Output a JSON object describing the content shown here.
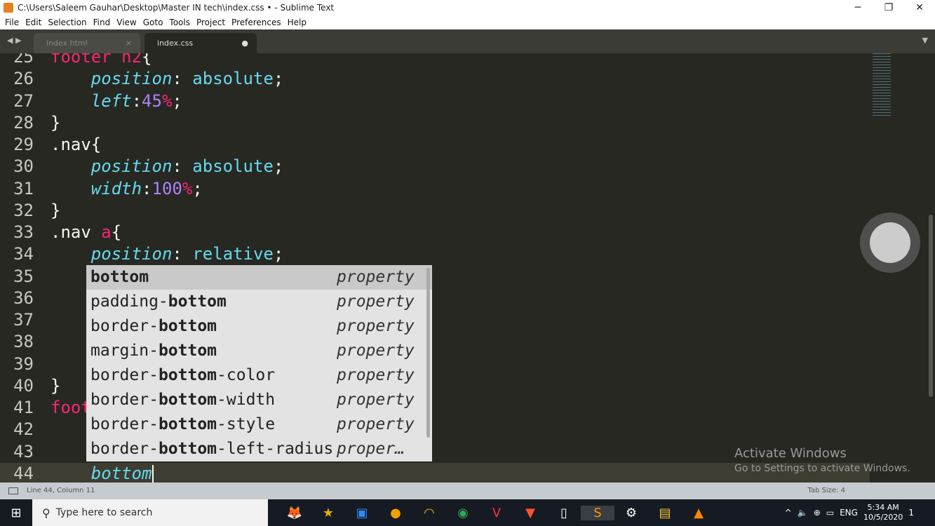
{
  "window": {
    "title": "C:\\Users\\Saleem Gauhar\\Desktop\\Master IN tech\\index.css • - Sublime Text",
    "minimize": "─",
    "restore": "❐",
    "close": "✕"
  },
  "menu": [
    "File",
    "Edit",
    "Selection",
    "Find",
    "View",
    "Goto",
    "Tools",
    "Project",
    "Preferences",
    "Help"
  ],
  "tabs": [
    {
      "label": "index.html",
      "close": "×"
    },
    {
      "label": "index.css",
      "modified": "●"
    }
  ],
  "tabnav": {
    "arrows": "◀ ▶",
    "menu": "▼"
  },
  "lines": [
    {
      "n": "25",
      "t": [
        [
          "kw",
          "footer h2"
        ],
        [
          "",
          "{"
        ]
      ]
    },
    {
      "n": "26",
      "t": [
        [
          "",
          "    "
        ],
        [
          "pr",
          "position"
        ],
        [
          "",
          ": "
        ],
        [
          "vl",
          "absolute"
        ],
        [
          "",
          ";"
        ]
      ]
    },
    {
      "n": "27",
      "t": [
        [
          "",
          "    "
        ],
        [
          "pr",
          "left"
        ],
        [
          "",
          ":"
        ],
        [
          "nu",
          "45"
        ],
        [
          "kw",
          "%"
        ],
        [
          "",
          ";"
        ]
      ]
    },
    {
      "n": "28",
      "t": [
        [
          "",
          "}"
        ]
      ]
    },
    {
      "n": "29",
      "t": [
        [
          "",
          ".nav{"
        ]
      ]
    },
    {
      "n": "30",
      "t": [
        [
          "",
          "    "
        ],
        [
          "pr",
          "position"
        ],
        [
          "",
          ": "
        ],
        [
          "vl",
          "absolute"
        ],
        [
          "",
          ";"
        ]
      ]
    },
    {
      "n": "31",
      "t": [
        [
          "",
          "    "
        ],
        [
          "pr",
          "width"
        ],
        [
          "",
          ":"
        ],
        [
          "nu",
          "100"
        ],
        [
          "kw",
          "%"
        ],
        [
          "",
          ";"
        ]
      ]
    },
    {
      "n": "32",
      "t": [
        [
          "",
          "}"
        ]
      ]
    },
    {
      "n": "33",
      "t": [
        [
          "",
          ".nav "
        ],
        [
          "kw",
          "a"
        ],
        [
          "",
          "{"
        ]
      ]
    },
    {
      "n": "34",
      "t": [
        [
          "",
          "    "
        ],
        [
          "pr",
          "position"
        ],
        [
          "",
          ": "
        ],
        [
          "vl",
          "relative"
        ],
        [
          "",
          ";"
        ]
      ]
    },
    {
      "n": "35",
      "t": []
    },
    {
      "n": "36",
      "t": []
    },
    {
      "n": "37",
      "t": []
    },
    {
      "n": "38",
      "t": []
    },
    {
      "n": "39",
      "t": []
    },
    {
      "n": "40",
      "t": [
        [
          "",
          "}"
        ]
      ]
    },
    {
      "n": "41",
      "t": [
        [
          "kw",
          "foot"
        ]
      ]
    },
    {
      "n": "42",
      "t": []
    },
    {
      "n": "43",
      "t": []
    },
    {
      "n": "44",
      "t": [
        [
          "",
          "    "
        ],
        [
          "pr",
          "bottom"
        ]
      ],
      "current": true
    }
  ],
  "autocomplete": [
    {
      "pre": "",
      "match": "bottom",
      "post": "",
      "kind": "property"
    },
    {
      "pre": "padding-",
      "match": "bottom",
      "post": "",
      "kind": "property"
    },
    {
      "pre": "border-",
      "match": "bottom",
      "post": "",
      "kind": "property"
    },
    {
      "pre": "margin-",
      "match": "bottom",
      "post": "",
      "kind": "property"
    },
    {
      "pre": "border-",
      "match": "bottom",
      "post": "-color",
      "kind": "property"
    },
    {
      "pre": "border-",
      "match": "bottom",
      "post": "-width",
      "kind": "property"
    },
    {
      "pre": "border-",
      "match": "bottom",
      "post": "-style",
      "kind": "property"
    },
    {
      "pre": "border-",
      "match": "bottom",
      "post": "-left-radius",
      "kind": "proper…"
    }
  ],
  "watermark": {
    "line1": "Activate Windows",
    "line2": "Go to Settings to activate Windows."
  },
  "status": {
    "position": "Line 44, Column 11",
    "tab_size": "Tab Size: 4"
  },
  "taskbar": {
    "search_placeholder": "Type here to search",
    "apps": [
      "firefox",
      "movie-maker",
      "zoom",
      "app",
      "app2",
      "chrome",
      "vivaldi",
      "brave",
      "file",
      "sublime-text",
      "settings",
      "file-explorer",
      "vlc"
    ],
    "tray": {
      "lang": "ENG",
      "time": "5:34 AM",
      "date": "10/5/2020",
      "notifications": "1"
    }
  },
  "colors": {
    "keyword": "#f92672",
    "property": "#66d9ef",
    "number": "#ae81ff",
    "background": "#272822"
  }
}
